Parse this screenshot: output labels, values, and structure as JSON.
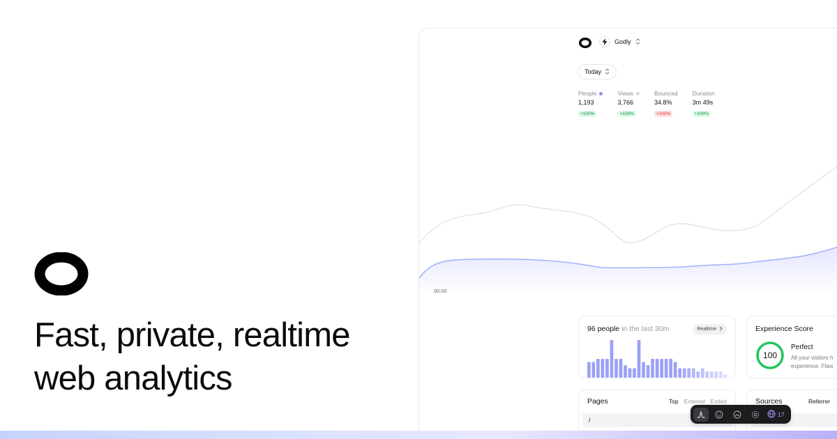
{
  "hero": {
    "title_line1": "Fast, private, realtime",
    "title_line2": "web analytics"
  },
  "app": {
    "site": {
      "name": "Godly",
      "icon": "bolt-icon"
    },
    "date_range": "Today",
    "metrics": [
      {
        "label": "People",
        "value": "1,193",
        "change": "+100%",
        "trend": "up",
        "dot_color": "#8b8ff5"
      },
      {
        "label": "Views",
        "value": "3,766",
        "change": "+100%",
        "trend": "up",
        "dot_color": "#d6d6dc"
      },
      {
        "label": "Bounced",
        "value": "34.8%",
        "change": "+100%",
        "trend": "down"
      },
      {
        "label": "Duration",
        "value": "3m 49s",
        "change": "+100%",
        "trend": "up"
      }
    ],
    "chart_time_label": "00:00",
    "realtime": {
      "count_text": "96 people",
      "suffix_text": "in the last 30m",
      "button_label": "Realtime",
      "bar_values": [
        5,
        5,
        6,
        6,
        6,
        12,
        6,
        6,
        4,
        3,
        3,
        12,
        5,
        4,
        6,
        6,
        6,
        6,
        6,
        5,
        3,
        3,
        3,
        3,
        2,
        3,
        2,
        2,
        2,
        2,
        1
      ]
    },
    "experience": {
      "title": "Experience Score",
      "score": "100",
      "rating": "Perfect",
      "desc_line1": "All your visitors h",
      "desc_line2": "experience. Flaw"
    },
    "pages": {
      "title": "Pages",
      "tabs": [
        "Top",
        "Entered",
        "Exited"
      ],
      "active_tab": "Top",
      "first_row": "/"
    },
    "sources": {
      "title": "Sources",
      "tab": "Referrer"
    },
    "dock": {
      "items": [
        "trend-icon",
        "smile-icon",
        "gauge-icon",
        "settings-icon"
      ],
      "globe_count": "17"
    }
  },
  "colors": {
    "accent": "#8b8ff5",
    "people_line": "#a5b4fc",
    "views_line": "#e4e4e7",
    "score_ring": "#22c55e",
    "up_badge": "#15803d",
    "down_badge": "#dc2626"
  }
}
